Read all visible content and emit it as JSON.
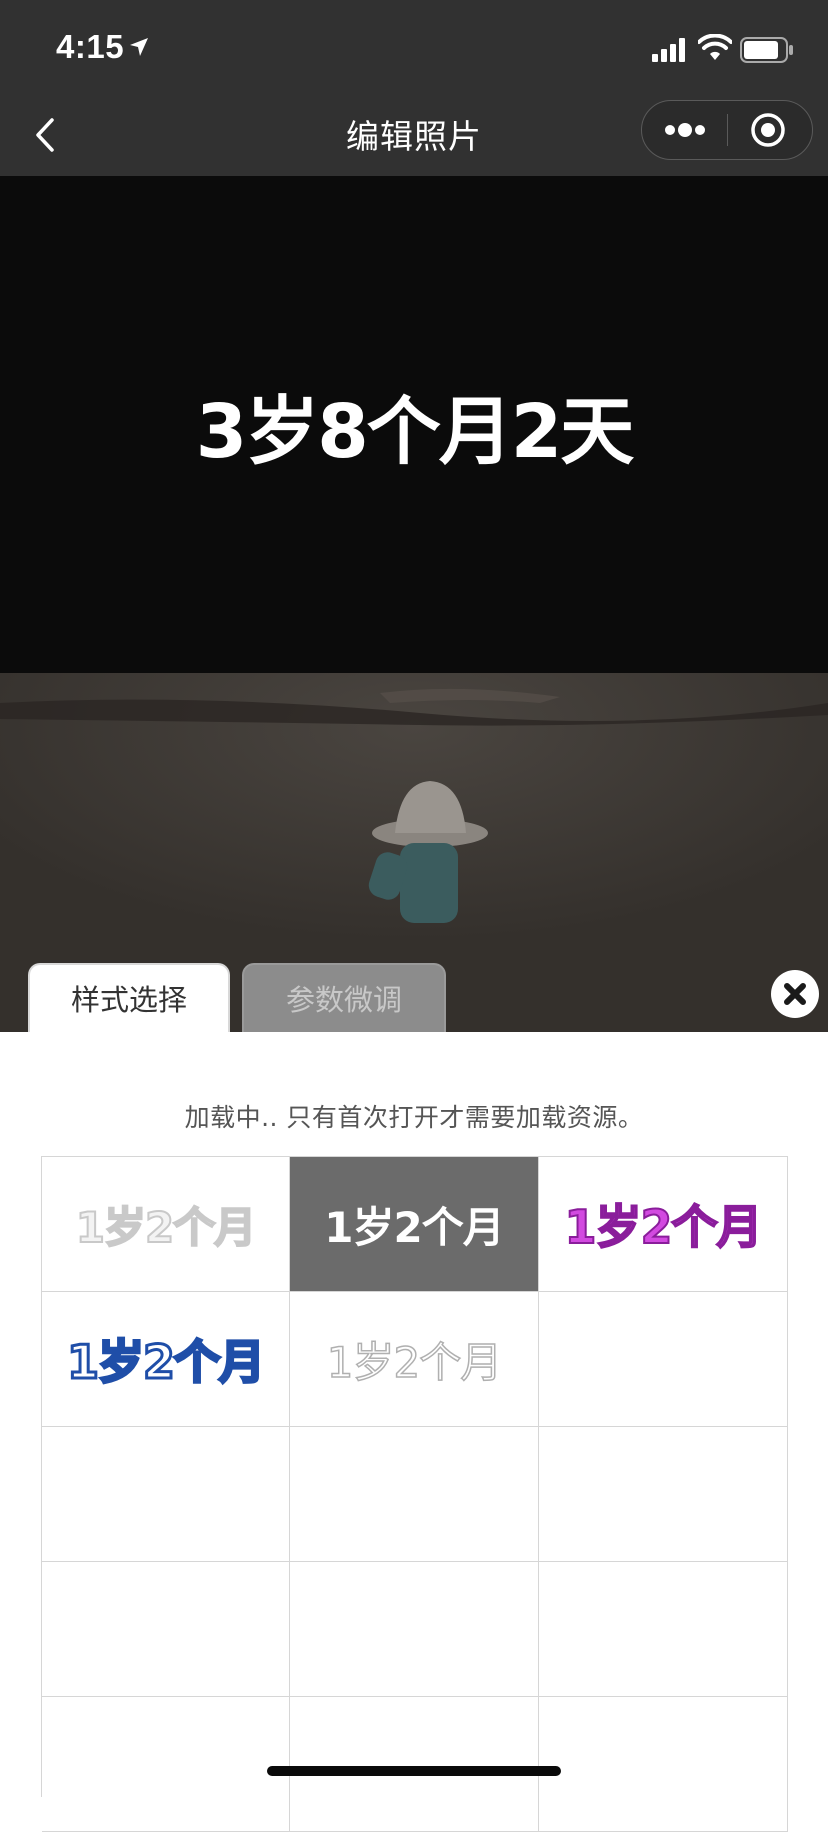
{
  "status_bar": {
    "time": "4:15"
  },
  "nav": {
    "title": "编辑照片"
  },
  "photo": {
    "overlay_text": "3岁8个月2天"
  },
  "tabs": [
    {
      "label": "样式选择",
      "active": true
    },
    {
      "label": "参数微调",
      "active": false
    }
  ],
  "panel": {
    "loading_text": "加载中.. 只有首次打开才需要加载资源。"
  },
  "style_grid": {
    "cells": [
      {
        "text": "1岁2个月",
        "style": "outline-gray"
      },
      {
        "text": "1岁2个月",
        "style": "white-on-gray",
        "selected": true
      },
      {
        "text": "1岁2个月",
        "style": "purple"
      },
      {
        "text": "1岁2个月",
        "style": "blue-outline"
      },
      {
        "text": "1岁2个月",
        "style": "thin-outline"
      },
      {
        "text": "",
        "style": "empty"
      },
      {
        "text": "",
        "style": "empty"
      },
      {
        "text": "",
        "style": "empty"
      },
      {
        "text": "",
        "style": "empty"
      },
      {
        "text": "",
        "style": "empty"
      },
      {
        "text": "",
        "style": "empty"
      },
      {
        "text": "",
        "style": "empty"
      },
      {
        "text": "",
        "style": "empty"
      },
      {
        "text": "",
        "style": "empty"
      },
      {
        "text": "",
        "style": "empty"
      }
    ]
  },
  "colors": {
    "bar_bg": "#313131",
    "selected_cell_bg": "#6b6b6b",
    "purple_text": "#d24ae0",
    "blue_outline": "#1f4ea8"
  },
  "icons": [
    "location-arrow-icon",
    "signal-icon",
    "wifi-icon",
    "battery-icon",
    "back-chevron-icon",
    "more-dots-icon",
    "target-circle-icon",
    "close-x-icon"
  ]
}
